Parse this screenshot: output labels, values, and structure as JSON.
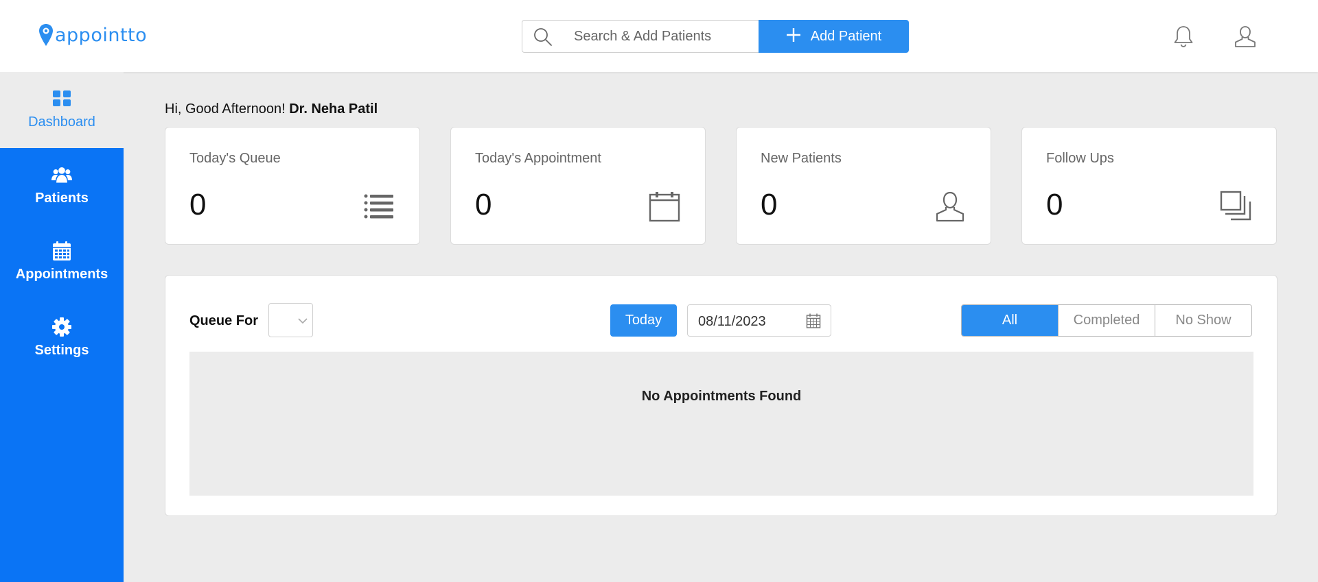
{
  "app": {
    "logo_text": "appointto",
    "brand_color": "#2b8ef0",
    "sidebar_color": "#0a74f5"
  },
  "header": {
    "search_placeholder": "Search & Add Patients",
    "add_patient_label": "Add Patient",
    "icons": [
      "search-icon",
      "plus-icon",
      "bell-icon",
      "user-icon"
    ]
  },
  "sidebar": {
    "items": [
      {
        "label": "Dashboard",
        "icon": "dashboard-grid-icon",
        "active": true
      },
      {
        "label": "Patients",
        "icon": "users-group-icon",
        "active": false
      },
      {
        "label": "Appointments",
        "icon": "calendar-icon",
        "active": false
      },
      {
        "label": "Settings",
        "icon": "gear-icon",
        "active": false
      }
    ]
  },
  "greeting": {
    "prefix": "Hi, Good Afternoon!",
    "name": "Dr. Neha Patil"
  },
  "cards": [
    {
      "title": "Today's Queue",
      "value": "0",
      "icon": "list-icon"
    },
    {
      "title": "Today's Appointment",
      "value": "0",
      "icon": "calendar-icon"
    },
    {
      "title": "New Patients",
      "value": "0",
      "icon": "user-icon"
    },
    {
      "title": "Follow Ups",
      "value": "0",
      "icon": "stacked-squares-icon"
    }
  ],
  "queue": {
    "label": "Queue For",
    "selected": "",
    "today_label": "Today",
    "date": "08/11/2023",
    "filters": [
      {
        "label": "All",
        "active": true
      },
      {
        "label": "Completed",
        "active": false
      },
      {
        "label": "No Show",
        "active": false
      }
    ],
    "empty_message": "No Appointments Found"
  }
}
